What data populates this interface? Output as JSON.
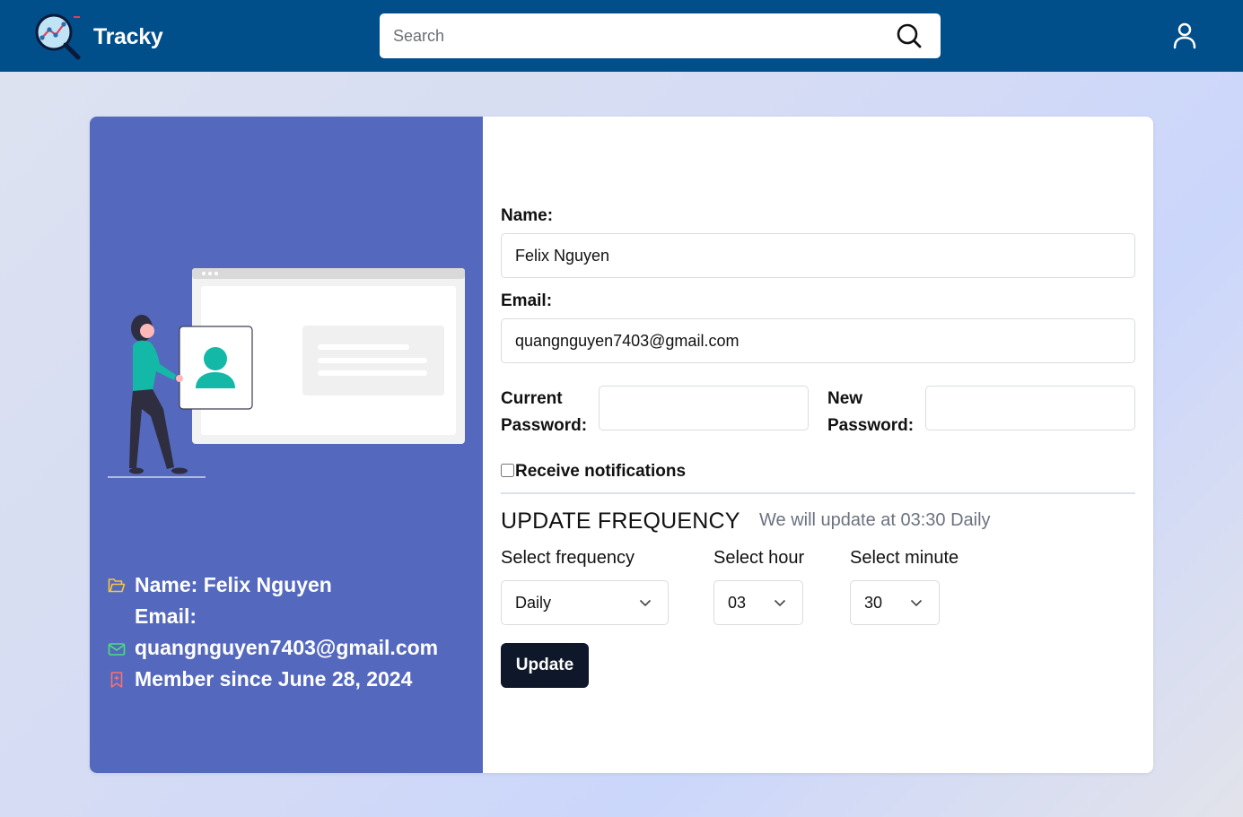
{
  "app": {
    "name": "Tracky"
  },
  "search": {
    "placeholder": "Search"
  },
  "profile_card": {
    "name_line": "Name: Felix Nguyen",
    "email_label": "Email:",
    "email_value": "quangnguyen7403@gmail.com",
    "member_line": "Member since June 28, 2024"
  },
  "form": {
    "name_label": "Name:",
    "name_value": "Felix Nguyen",
    "email_label": "Email:",
    "email_value": "quangnguyen7403@gmail.com",
    "current_password_label_1": "Current",
    "current_password_label_2": "Password:",
    "new_password_label_1": "New",
    "new_password_label_2": "Password:",
    "notifications_label": "Receive notifications",
    "notifications_checked": false
  },
  "frequency": {
    "title": "UPDATE FREQUENCY",
    "note": "We will update at 03:30 Daily",
    "frequency_label": "Select frequency",
    "frequency_value": "Daily",
    "hour_label": "Select hour",
    "hour_value": "03",
    "minute_label": "Select minute",
    "minute_value": "30",
    "update_button": "Update"
  },
  "colors": {
    "navbar": "#004e8a",
    "left_panel": "#5469bd",
    "button": "#0f172a",
    "accent_teal": "#14b8a6"
  }
}
